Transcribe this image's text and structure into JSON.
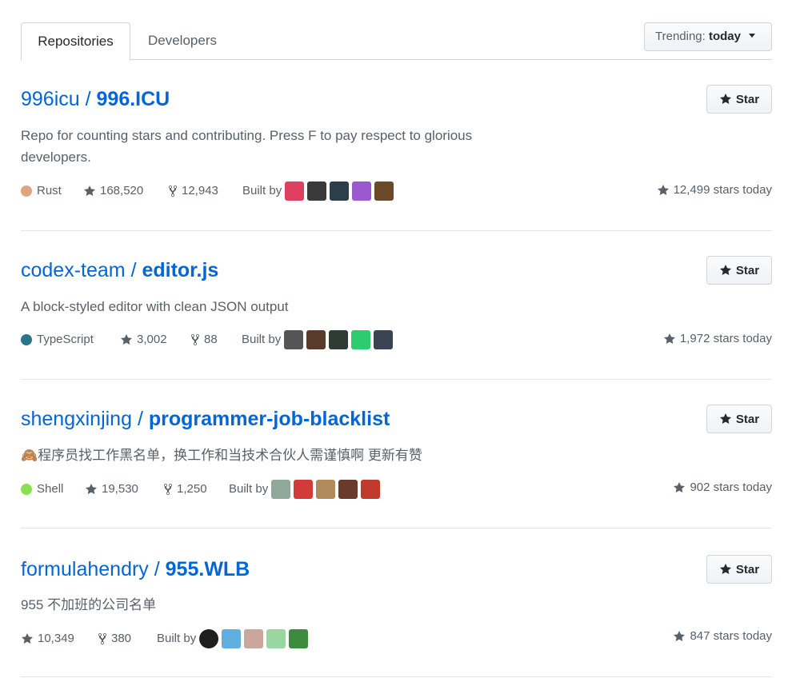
{
  "tabs": [
    {
      "label": "Repositories",
      "selected": true
    },
    {
      "label": "Developers",
      "selected": false
    }
  ],
  "trending": {
    "prefix": "Trending:",
    "value": "today"
  },
  "star_label": "Star",
  "built_by_label": "Built by",
  "repos": [
    {
      "owner": "996icu",
      "name": "996.ICU",
      "description": "Repo for counting stars and contributing. Press F to pay respect to glorious developers.",
      "language": "Rust",
      "language_color": "#dea584",
      "stars": "168,520",
      "forks": "12,943",
      "stars_today": "12,499 stars today",
      "avatars": [
        "#e0405f",
        "#3a3a3a",
        "#2d3f4a",
        "#9b59d0",
        "#6b4a2a"
      ]
    },
    {
      "owner": "codex-team",
      "name": "editor.js",
      "description": "A block-styled editor with clean JSON output",
      "language": "TypeScript",
      "language_color": "#2b7489",
      "stars": "3,002",
      "forks": "88",
      "stars_today": "1,972 stars today",
      "avatars": [
        "#555555",
        "#5a3b2a",
        "#2e3c33",
        "#2ecc71",
        "#3a4452"
      ]
    },
    {
      "owner": "shengxinjing",
      "name": "programmer-job-blacklist",
      "description": "程序员找工作黑名单，换工作和当技术合伙人需谨慎啊 更新有赞",
      "emoji": "🙈",
      "language": "Shell",
      "language_color": "#89e051",
      "stars": "19,530",
      "forks": "1,250",
      "stars_today": "902 stars today",
      "avatars": [
        "#8fa89a",
        "#d33b3b",
        "#b08a5a",
        "#6a3a2a",
        "#c0392b"
      ]
    },
    {
      "owner": "formulahendry",
      "name": "955.WLB",
      "description": "955 不加班的公司名单",
      "language": "",
      "language_color": "",
      "stars": "10,349",
      "forks": "380",
      "stars_today": "847 stars today",
      "avatars": [
        "#1e1e1e",
        "#5fb0e0",
        "#c9a79a",
        "#9ad6a0",
        "#3d8b3d"
      ]
    }
  ]
}
